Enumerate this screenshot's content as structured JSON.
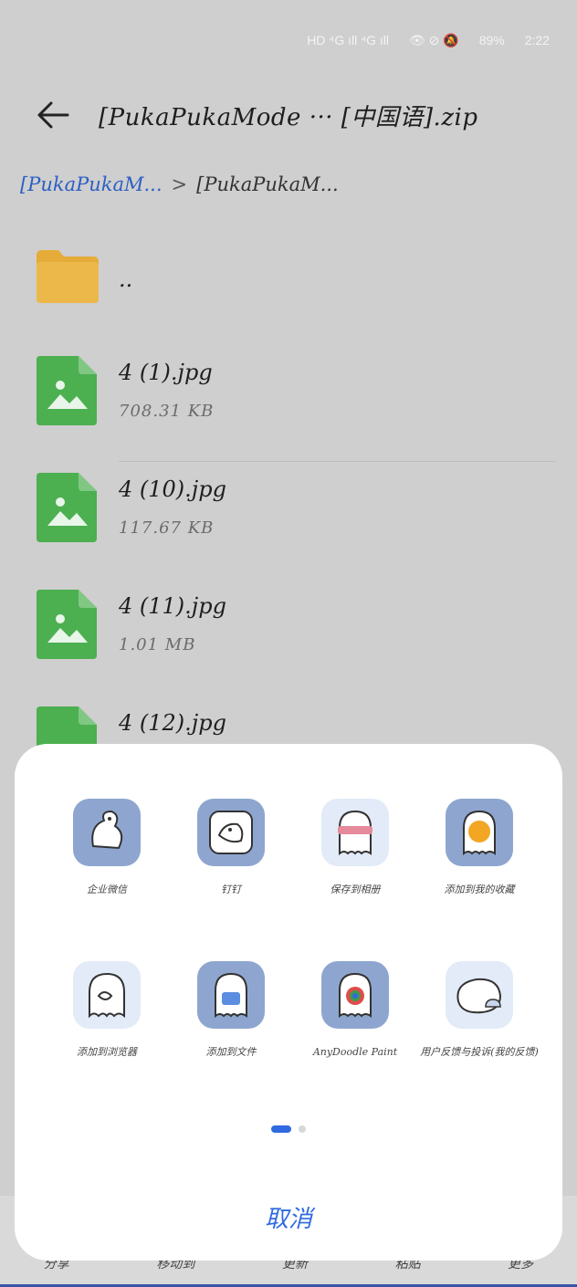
{
  "status_bar": {
    "left_icons": "HD ⁴G ıll ⁴G ıll",
    "right_icons": "👁 ⊘ 🔕",
    "battery": "89%",
    "time": "2:22"
  },
  "header": {
    "title": "[PukaPukaMode ··· [中国语].zip"
  },
  "breadcrumb": {
    "parent": "[PukaPukaM...",
    "separator": ">",
    "current": "[PukaPukaM..."
  },
  "files": [
    {
      "name": "..",
      "size": "",
      "type": "folder"
    },
    {
      "name": "4 (1).jpg",
      "size": "708.31 KB",
      "type": "image"
    },
    {
      "name": "4 (10).jpg",
      "size": "117.67 KB",
      "type": "image"
    },
    {
      "name": "4 (11).jpg",
      "size": "1.01 MB",
      "type": "image"
    },
    {
      "name": "4 (12).jpg",
      "size": "",
      "type": "image"
    }
  ],
  "bottom_bar": [
    "分享",
    "移动到",
    "更新",
    "粘贴",
    "更多"
  ],
  "share_sheet": {
    "apps": [
      {
        "label": "企业微信",
        "icon": "squirrel-icon"
      },
      {
        "label": "钉钉",
        "icon": "penguin-icon"
      },
      {
        "label": "保存到相册",
        "icon": "ghost-mask-icon"
      },
      {
        "label": "添加到我的收藏",
        "icon": "ghost-orange-icon"
      },
      {
        "label": "添加到浏览器",
        "icon": "ghost-sketch-icon"
      },
      {
        "label": "添加到文件",
        "icon": "ghost-phone-icon"
      },
      {
        "label": "AnyDoodle Paint",
        "icon": "ghost-paint-icon"
      },
      {
        "label": "用户反馈与投诉(我的反馈)",
        "icon": "ghost-cloud-icon"
      }
    ],
    "cancel_label": "取消",
    "page_index": 1,
    "page_count": 2
  },
  "colors": {
    "accent": "#2f6ae0",
    "link": "#2d5fc4",
    "folder": "#e5ac3a",
    "image_file": "#4caf50",
    "app_icon_bg": "#8ea6cf"
  }
}
